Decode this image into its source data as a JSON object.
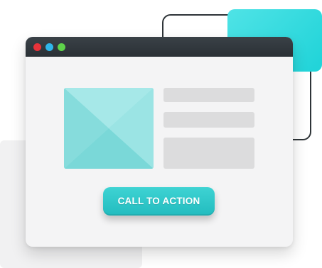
{
  "window": {
    "controls": [
      "close-dot",
      "minimize-dot",
      "maximize-dot"
    ]
  },
  "content": {
    "image_icon": "image-placeholder-icon",
    "cta_label": "CALL TO ACTION"
  },
  "colors": {
    "accent": "#22bcbf",
    "title_bar": "#2e3438",
    "dot_red": "#e8333a",
    "dot_blue": "#2fb6ea",
    "dot_green": "#5ed24a",
    "placeholder_fill": "#8fe0e0",
    "text_line_fill": "#dcdcdd"
  }
}
